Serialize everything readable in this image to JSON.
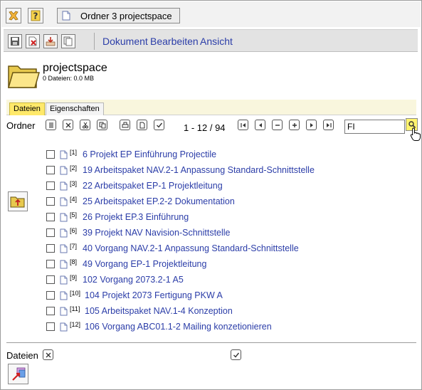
{
  "window": {
    "tab_title": "Ordner 3 projectspace"
  },
  "menu": {
    "items": [
      "Dokument",
      "Bearbeiten",
      "Ansicht"
    ]
  },
  "header": {
    "title": "projectspace",
    "subtitle": "0 Dateien: 0.0 MB"
  },
  "tabs": [
    "Dateien",
    "Eigenschaften"
  ],
  "toolbar": {
    "ordner_label": "Ordner",
    "pager_text": "1 - 12 / 94"
  },
  "search": {
    "value": "FI"
  },
  "files": [
    {
      "num": "[1]",
      "title": "6 Projekt EP Einführung Projectile"
    },
    {
      "num": "[2]",
      "title": "19 Arbeitspaket NAV.2-1 Anpassung Standard-Schnittstelle"
    },
    {
      "num": "[3]",
      "title": "22 Arbeitspaket EP-1 Projektleitung"
    },
    {
      "num": "[4]",
      "title": "25 Arbeitspaket EP.2-2 Dokumentation"
    },
    {
      "num": "[5]",
      "title": "26 Projekt EP.3 Einführung"
    },
    {
      "num": "[6]",
      "title": "39 Projekt NAV Navision-Schnittstelle"
    },
    {
      "num": "[7]",
      "title": "40 Vorgang NAV.2-1 Anpassung Standard-Schnittstelle"
    },
    {
      "num": "[8]",
      "title": "49 Vorgang EP-1 Projektleitung"
    },
    {
      "num": "[9]",
      "title": "102 Vorgang 2073.2-1 A5"
    },
    {
      "num": "[10]",
      "title": "104 Projekt 2073 Fertigung PKW A"
    },
    {
      "num": "[11]",
      "title": "105 Arbeitspaket NAV.1-4 Konzeption"
    },
    {
      "num": "[12]",
      "title": "106 Vorgang ABC01.1-2 Mailing konzetionieren"
    }
  ],
  "footer": {
    "dateien_label": "Dateien"
  },
  "colors": {
    "link": "#2b3da8",
    "tab_active": "#ffe96a",
    "tab_strip": "#f9f6dd",
    "menubar": "#e3e3e3"
  }
}
